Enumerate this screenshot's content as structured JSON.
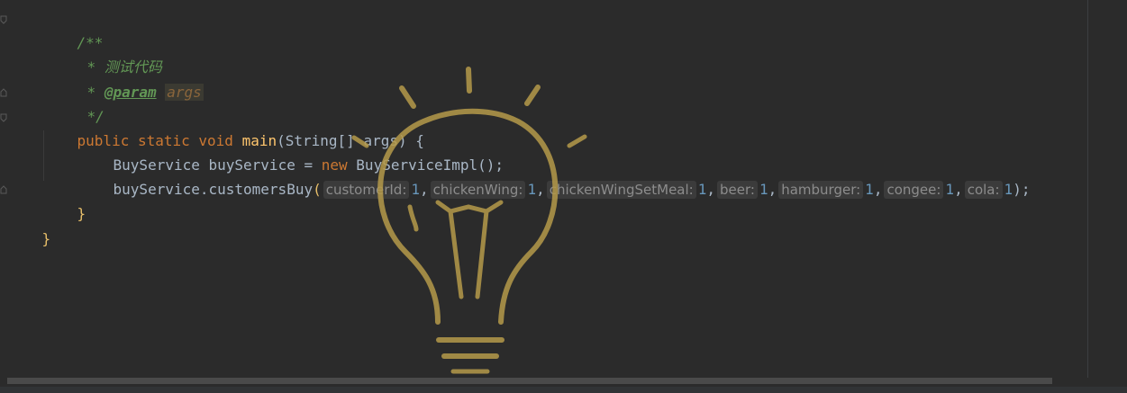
{
  "editor": {
    "lines": {
      "doc_open": "/**",
      "doc_star": "*",
      "doc_desc": "测试代码",
      "doc_param_tag": "@param",
      "doc_param_name": "args",
      "doc_close": "*/",
      "kw_public": "public",
      "kw_static": "static",
      "kw_void": "void",
      "method_name": "main",
      "main_params": "(String[] args) {",
      "type_buyservice": "BuyService",
      "var_buyservice": "buyService",
      "assign": "=",
      "kw_new": "new",
      "impl_class": "BuyServiceImpl",
      "impl_call": "();",
      "call_target": "buyService.customersBuy",
      "open_paren": "(",
      "close_call": ");",
      "comma": ",",
      "close_method": "}",
      "close_class": "}"
    },
    "args": [
      {
        "hint": "customerId:",
        "value": "1"
      },
      {
        "hint": "chickenWing:",
        "value": "1"
      },
      {
        "hint": "chickenWingSetMeal:",
        "value": "1"
      },
      {
        "hint": "beer:",
        "value": "1"
      },
      {
        "hint": "hamburger:",
        "value": "1"
      },
      {
        "hint": "congee:",
        "value": "1"
      },
      {
        "hint": "cola:",
        "value": "1"
      }
    ]
  },
  "colors": {
    "background": "#2b2b2b",
    "keyword": "#cc7832",
    "doc_comment": "#629755",
    "method": "#ffc66d",
    "number": "#6897bb",
    "hint_bg": "#3b3b3b",
    "bulb": "#b59a4a"
  },
  "overlay": {
    "icon": "lightbulb-icon"
  }
}
